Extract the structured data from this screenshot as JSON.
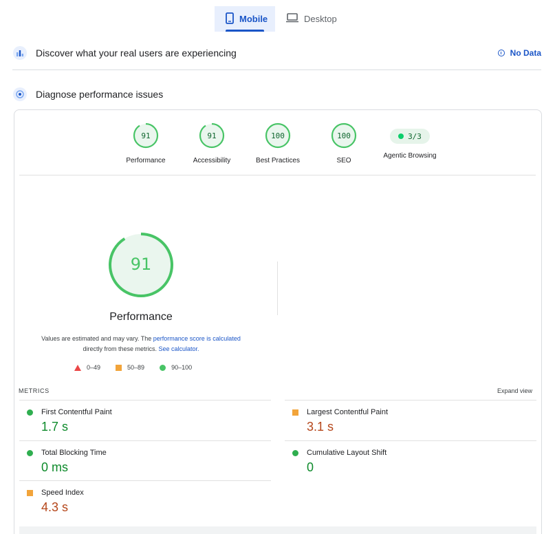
{
  "tabs": [
    {
      "label": "Mobile",
      "icon": "phone-icon",
      "active": true
    },
    {
      "label": "Desktop",
      "icon": "laptop-icon",
      "active": false
    }
  ],
  "crux": {
    "title": "Discover what your real users are experiencing",
    "status": "No Data"
  },
  "diagnose": {
    "title": "Diagnose performance issues"
  },
  "categories": [
    {
      "score": "91",
      "label": "Performance",
      "fraction": 0.91
    },
    {
      "score": "91",
      "label": "Accessibility",
      "fraction": 0.91
    },
    {
      "score": "100",
      "label": "Best Practices",
      "fraction": 1.0
    },
    {
      "score": "100",
      "label": "SEO",
      "fraction": 1.0
    },
    {
      "score": "3/3",
      "label": "Agentic Browsing"
    }
  ],
  "performance": {
    "score": "91",
    "fraction": 0.91,
    "title": "Performance",
    "note_prefix": "Values are estimated and may vary. The ",
    "note_link1": "performance score is calculated",
    "note_middle": " directly from these metrics. ",
    "note_link2": "See calculator."
  },
  "legend": [
    {
      "shape": "triangle",
      "range": "0–49",
      "color": "#eb4747"
    },
    {
      "shape": "square",
      "range": "50–89",
      "color": "#f2a43a"
    },
    {
      "shape": "circle",
      "range": "90–100",
      "color": "#48c466"
    }
  ],
  "metrics_header": {
    "label": "METRICS",
    "expand": "Expand view"
  },
  "metrics": [
    {
      "name": "First Contentful Paint",
      "value": "1.7 s",
      "rating": "good"
    },
    {
      "name": "Largest Contentful Paint",
      "value": "3.1 s",
      "rating": "average"
    },
    {
      "name": "Total Blocking Time",
      "value": "0 ms",
      "rating": "good"
    },
    {
      "name": "Cumulative Layout Shift",
      "value": "0",
      "rating": "good"
    },
    {
      "name": "Speed Index",
      "value": "4.3 s",
      "rating": "average"
    }
  ],
  "colors": {
    "accent": "#1a55c7",
    "pass": "#0cce6b",
    "average": "#f2a43a",
    "fail": "#eb4747"
  }
}
